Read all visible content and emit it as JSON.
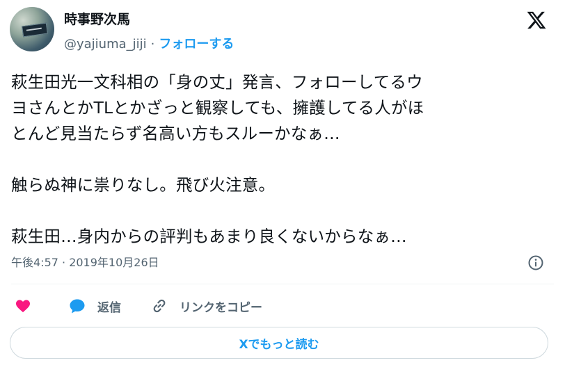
{
  "user": {
    "display_name": "時事野次馬",
    "handle": "@yajiuma_jiji",
    "separator": "·",
    "follow_label": "フォローする"
  },
  "tweet": {
    "lines": [
      "萩生田光一文科相の「身の丈」発言、フォローしてるウ",
      "ヨさんとかTLとかざっと観察しても、擁護してる人がほ",
      "とんど見当たらず名高い方もスルーかなぁ…",
      "",
      "触らぬ神に祟りなし。飛び火注意。",
      "",
      "萩生田…身内からの評判もあまり良くないからなぁ…"
    ],
    "timestamp": "午後4:57 · 2019年10月26日"
  },
  "actions": {
    "reply_label": "返信",
    "copy_link_label": "リンクをコピー"
  },
  "read_more_label": "Xでもっと読む",
  "colors": {
    "accent": "#1d9bf0",
    "like": "#f91880",
    "text": "#0f1419",
    "muted": "#536471"
  },
  "icons": [
    "x-logo-icon",
    "info-icon",
    "heart-icon",
    "reply-bubble-icon",
    "link-icon"
  ]
}
